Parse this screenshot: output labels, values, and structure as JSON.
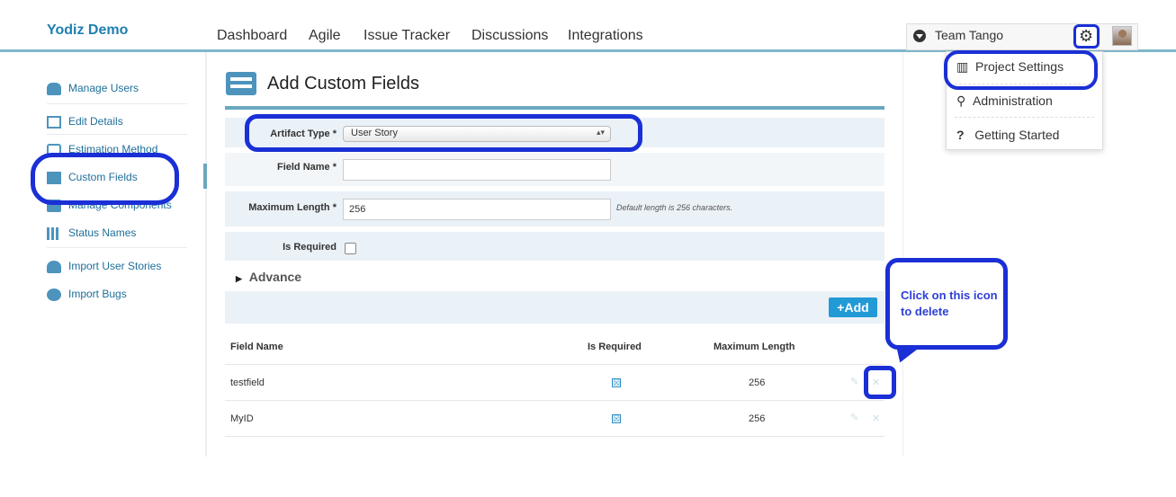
{
  "app": {
    "brand": "Yodiz Demo"
  },
  "nav": [
    "Dashboard",
    "Agile",
    "Issue Tracker",
    "Discussions",
    "Integrations"
  ],
  "team": {
    "label": "Team Tango"
  },
  "settings_menu": [
    "Project Settings",
    "Administration",
    "Getting Started"
  ],
  "sidebar": [
    {
      "label": "Manage Users",
      "icon": "users-icon"
    },
    {
      "label": "Edit Details",
      "icon": "edit-icon"
    },
    {
      "label": "Estimation Method",
      "icon": "shirt-icon"
    },
    {
      "label": "Custom Fields",
      "icon": "fields-icon"
    },
    {
      "label": "Manage Components",
      "icon": "components-icon"
    },
    {
      "label": "Status Names",
      "icon": "bars-icon"
    },
    {
      "label": "Import User Stories",
      "icon": "import-icon"
    },
    {
      "label": "Import Bugs",
      "icon": "bug-icon"
    }
  ],
  "page": {
    "title": "Add Custom Fields"
  },
  "form": {
    "artifact_label": "Artifact Type *",
    "artifact_value": "User Story",
    "field_name_label": "Field Name *",
    "field_name_value": "",
    "max_length_label": "Maximum Length *",
    "max_length_value": "256",
    "max_length_hint": "Default length is 256 characters.",
    "required_label": "Is Required",
    "advance_label": "Advance",
    "add_button": "+Add"
  },
  "table": {
    "headers": [
      "Field Name",
      "Is Required",
      "Maximum Length"
    ],
    "rows": [
      {
        "name": "testfield",
        "required": "☒",
        "max_length": "256"
      },
      {
        "name": "MyID",
        "required": "☒",
        "max_length": "256"
      }
    ]
  },
  "callout": {
    "text": "Click on this icon to delete"
  },
  "colors": {
    "brand": "#1f7fb0",
    "accent": "#229ad6",
    "annotation": "#1a2fd6",
    "row_bg": "#eaf1f7"
  }
}
